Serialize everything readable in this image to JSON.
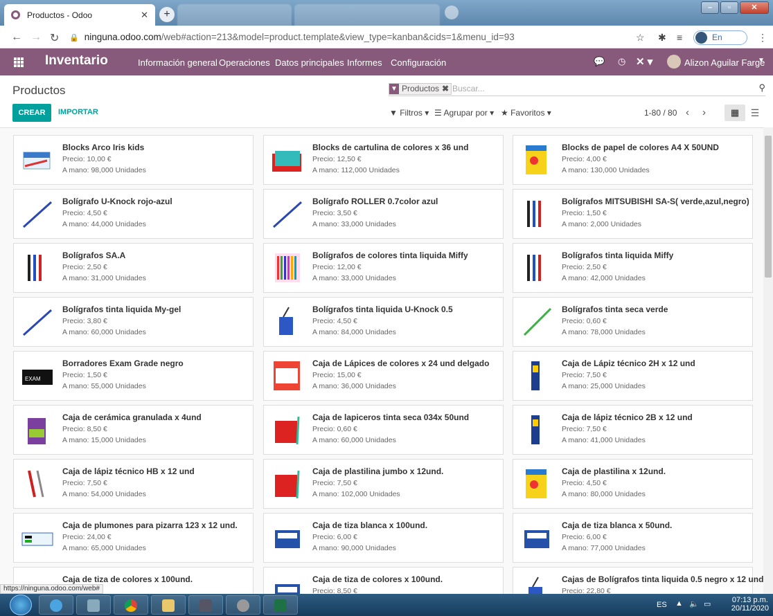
{
  "browser": {
    "tab_title": "Productos - Odoo",
    "url_host": "ninguna.odoo.com",
    "url_path": "/web#action=213&model=product.template&view_type=kanban&cids=1&menu_id=93",
    "profile_status": "En pausa",
    "status_url": "https://ninguna.odoo.com/web#"
  },
  "navbar": {
    "app_name": "Inventario",
    "menus": [
      "Información general",
      "Operaciones",
      "Datos principales",
      "Informes",
      "Configuración"
    ],
    "user_name": "Alizon Aguilar Farge"
  },
  "control": {
    "breadcrumb": "Productos",
    "facet": "Productos",
    "search_placeholder": "Buscar...",
    "create_label": "CREAR",
    "import_label": "IMPORTAR",
    "filters_label": "Filtros",
    "groupby_label": "Agrupar por",
    "favorites_label": "Favoritos",
    "pager": "1-80 / 80"
  },
  "products": [
    {
      "name": "Blocks Arco Iris kids",
      "price": "Precio: 10,00 €",
      "stock": "A mano: 98,000 Unidades",
      "icon": "notebook"
    },
    {
      "name": "Blocks de cartulina de colores x 36 und",
      "price": "Precio: 12,50 €",
      "stock": "A mano: 112,000 Unidades",
      "icon": "pad"
    },
    {
      "name": "Blocks de papel de colores A4 X 50UND",
      "price": "Precio: 4,00 €",
      "stock": "A mano: 130,000 Unidades",
      "icon": "paper"
    },
    {
      "name": "Bolígrafo U-Knock rojo-azul",
      "price": "Precio: 4,50 €",
      "stock": "A mano: 44,000 Unidades",
      "icon": "pen"
    },
    {
      "name": "Bolígrafo ROLLER 0.7color azul",
      "price": "Precio: 3,50 €",
      "stock": "A mano: 33,000 Unidades",
      "icon": "pen"
    },
    {
      "name": "Bolígrafos MITSUBISHI SA-S( verde,azul,negro)",
      "price": "Precio: 1,50 €",
      "stock": "A mano: 2,000 Unidades",
      "icon": "pens"
    },
    {
      "name": "Bolígrafos SA.A",
      "price": "Precio: 2,50 €",
      "stock": "A mano: 31,000 Unidades",
      "icon": "pens"
    },
    {
      "name": "Bolígrafos de colores tinta liquida Miffy",
      "price": "Precio: 12,00 €",
      "stock": "A mano: 33,000 Unidades",
      "icon": "colorpens"
    },
    {
      "name": "Bolígrafos tinta liquida Miffy",
      "price": "Precio: 2,50 €",
      "stock": "A mano: 42,000 Unidades",
      "icon": "pens"
    },
    {
      "name": "Bolígrafos tinta liquida My-gel",
      "price": "Precio: 3,80 €",
      "stock": "A mano: 60,000 Unidades",
      "icon": "pen"
    },
    {
      "name": "Bolígrafos tinta liquida U-Knock 0.5",
      "price": "Precio: 4,50 €",
      "stock": "A mano: 84,000 Unidades",
      "icon": "pencup"
    },
    {
      "name": "Bolígrafos tinta seca verde",
      "price": "Precio: 0,60 €",
      "stock": "A mano: 78,000 Unidades",
      "icon": "greenpen"
    },
    {
      "name": "Borradores Exam Grade negro",
      "price": "Precio: 1,50 €",
      "stock": "A mano: 55,000 Unidades",
      "icon": "eraser"
    },
    {
      "name": "Caja de Lápices de colores x 24 und delgado",
      "price": "Precio: 15,00 €",
      "stock": "A mano: 36,000 Unidades",
      "icon": "box"
    },
    {
      "name": "Caja de Lápiz técnico 2H x 12 und",
      "price": "Precio: 7,50 €",
      "stock": "A mano: 25,000 Unidades",
      "icon": "pencilbox"
    },
    {
      "name": "Caja de cerámica granulada x 4und",
      "price": "Precio: 8,50 €",
      "stock": "A mano: 15,000 Unidades",
      "icon": "jar"
    },
    {
      "name": "Caja de lapiceros tinta seca 034x 50und",
      "price": "Precio: 0,60 €",
      "stock": "A mano: 60,000 Unidades",
      "icon": "redbox"
    },
    {
      "name": "Caja de lápiz técnico 2B x 12 und",
      "price": "Precio: 7,50 €",
      "stock": "A mano: 41,000 Unidades",
      "icon": "pencilbox"
    },
    {
      "name": "Caja de lápiz técnico HB x 12 und",
      "price": "Precio: 7,50 €",
      "stock": "A mano: 54,000 Unidades",
      "icon": "pencils"
    },
    {
      "name": "Caja de plastilina jumbo x 12und.",
      "price": "Precio: 7,50 €",
      "stock": "A mano: 102,000 Unidades",
      "icon": "redbox"
    },
    {
      "name": "Caja de plastilina x 12und.",
      "price": "Precio: 4,50 €",
      "stock": "A mano: 80,000 Unidades",
      "icon": "paper"
    },
    {
      "name": "Caja de plumones para pizarra 123 x 12 und.",
      "price": "Precio: 24,00 €",
      "stock": "A mano: 65,000 Unidades",
      "icon": "markers"
    },
    {
      "name": "Caja de tiza blanca x 100und.",
      "price": "Precio: 6,00 €",
      "stock": "A mano: 90,000 Unidades",
      "icon": "chalk"
    },
    {
      "name": "Caja de tiza blanca x 50und.",
      "price": "Precio: 6,00 €",
      "stock": "A mano: 77,000 Unidades",
      "icon": "chalk"
    },
    {
      "name": "Caja de tiza de colores x 100und.",
      "price": "",
      "stock": "",
      "icon": "chalk"
    },
    {
      "name": "Caja de tiza de colores x 100und.",
      "price": "Precio: 8,50 €",
      "stock": "",
      "icon": "chalk"
    },
    {
      "name": "Cajas de Bolígrafos tinta liquida 0.5 negro x 12 und",
      "price": "Precio: 22,80 €",
      "stock": "",
      "icon": "pencup"
    }
  ],
  "taskbar": {
    "lang": "ES",
    "time": "07:13 p.m.",
    "date": "20/11/2020"
  },
  "colors": {
    "brand": "#875a7b",
    "primary_button": "#00a09d"
  }
}
